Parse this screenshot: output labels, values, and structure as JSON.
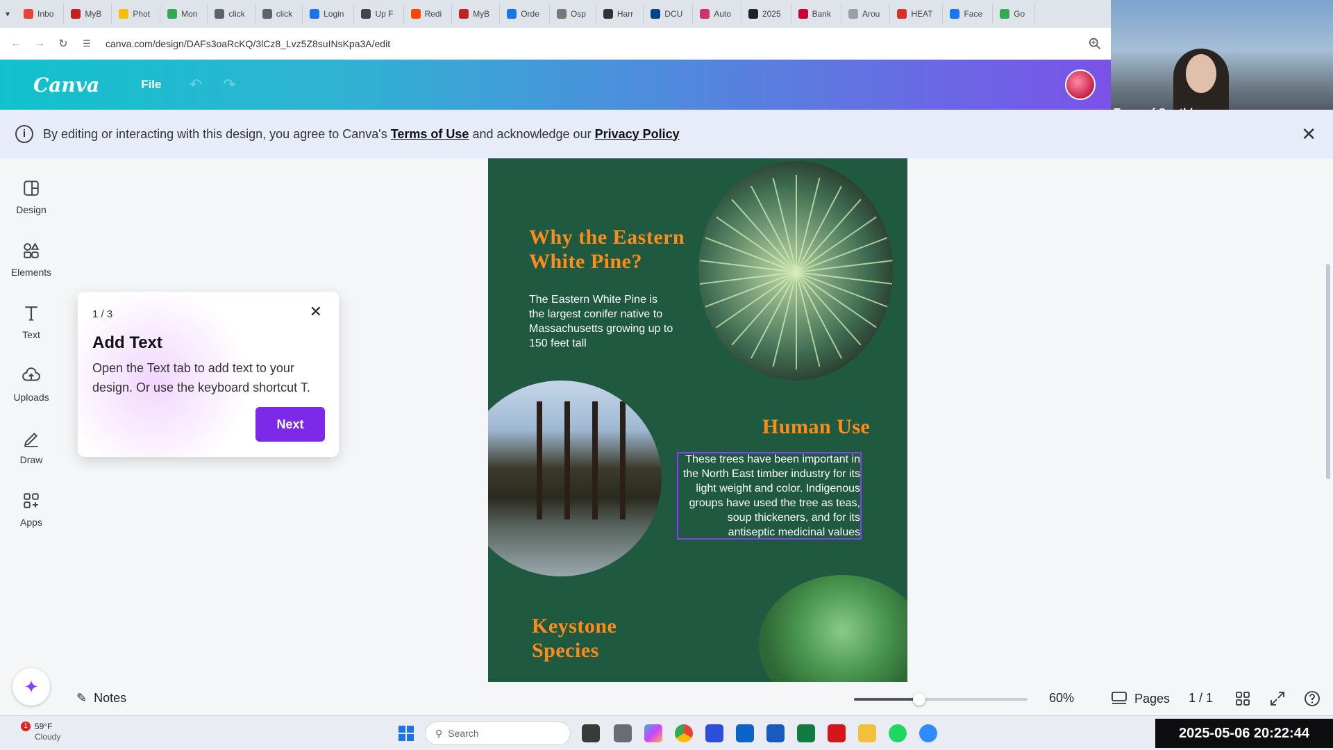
{
  "browser": {
    "tabs": [
      {
        "label": "Inbo",
        "color": "#ea4335"
      },
      {
        "label": "MyB",
        "color": "#c5221f"
      },
      {
        "label": "Phot",
        "color": "#fbbc04"
      },
      {
        "label": "Mon",
        "color": "#34a853"
      },
      {
        "label": "click",
        "color": "#5f6368"
      },
      {
        "label": "click",
        "color": "#5f6368"
      },
      {
        "label": "Login",
        "color": "#1a73e8"
      },
      {
        "label": "Up F",
        "color": "#444444"
      },
      {
        "label": "Redi",
        "color": "#ff4500"
      },
      {
        "label": "MyB",
        "color": "#c5221f"
      },
      {
        "label": "Orde",
        "color": "#1a73e8"
      },
      {
        "label": "Osp",
        "color": "#777777"
      },
      {
        "label": "Harr",
        "color": "#333333"
      },
      {
        "label": "DCU",
        "color": "#00448b"
      },
      {
        "label": "Auto",
        "color": "#cc3366"
      },
      {
        "label": "2025",
        "color": "#222222"
      },
      {
        "label": "Bank",
        "color": "#cc0033"
      },
      {
        "label": "Arou",
        "color": "#9aa0a6"
      },
      {
        "label": "HEAT",
        "color": "#d93025"
      },
      {
        "label": "Face",
        "color": "#1877f2"
      },
      {
        "label": "Go",
        "color": "#34a853"
      }
    ],
    "url": "canva.com/design/DAFs3oaRcKQ/3lCz8_Lvz5Z8suINsKpa3A/edit"
  },
  "canva": {
    "logo": "Canva",
    "file_menu": "File"
  },
  "video": {
    "name": "Town of Southborou..."
  },
  "notice": {
    "prefix": "By editing or interacting with this design, you agree to Canva's",
    "terms": "Terms of Use",
    "middle": "and acknowledge our",
    "privacy": "Privacy Policy"
  },
  "rail": {
    "items": [
      {
        "label": "Design",
        "icon": "design-icon"
      },
      {
        "label": "Elements",
        "icon": "elements-icon"
      },
      {
        "label": "Text",
        "icon": "text-icon"
      },
      {
        "label": "Uploads",
        "icon": "uploads-icon"
      },
      {
        "label": "Draw",
        "icon": "draw-icon"
      },
      {
        "label": "Apps",
        "icon": "apps-icon"
      }
    ]
  },
  "tour": {
    "step": "1 / 3",
    "title": "Add Text",
    "body": "Open the Text tab to add text to your design. Or use the keyboard shortcut T.",
    "next": "Next"
  },
  "poster": {
    "heading1_line1": "Why the Eastern",
    "heading1_line2": "White Pine?",
    "para1": "The Eastern White Pine is the largest conifer native to Massachusetts growing up to 150 feet tall",
    "heading2": "Human Use",
    "para2": "These trees have been important in the North East timber industry for its light weight and color. Indigenous groups have used the tree as teas, soup thickeners, and for its antiseptic medicinal values",
    "heading3_line1": "Keystone",
    "heading3_line2": "Species",
    "colors": {
      "background": "#1f5a40",
      "heading": "#ff8c1a"
    }
  },
  "bottombar": {
    "notes": "Notes",
    "zoom": "60%",
    "zoom_percent": 60,
    "pages": "Pages",
    "page_count": "1 / 1"
  },
  "taskbar": {
    "weather_temp": "59°F",
    "weather_desc": "Cloudy",
    "weather_alert": "1",
    "search": "Search",
    "clock": "2025-05-06  20:22:44"
  }
}
